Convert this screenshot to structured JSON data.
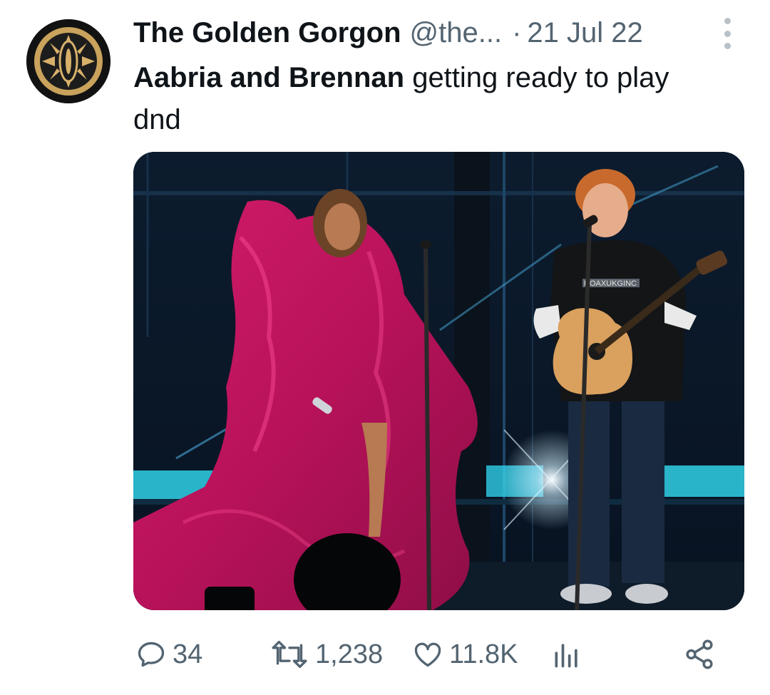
{
  "tweet": {
    "author": {
      "display_name": "The Golden Gorgon",
      "handle": "@the...",
      "avatar_icon": "golden-eye-logo"
    },
    "separator": "·",
    "date": "21 Jul 22",
    "text_bold": "Aabria and Brennan",
    "text_rest": " getting ready to play dnd",
    "media": {
      "shirt_text": "HOAXUKGINC"
    },
    "actions": {
      "replies": "34",
      "retweets": "1,238",
      "likes": "11.8K"
    }
  },
  "colors": {
    "text_primary": "#0f1419",
    "text_secondary": "#536471",
    "gown": "#c2175f",
    "stage": "#0b1a2a"
  }
}
